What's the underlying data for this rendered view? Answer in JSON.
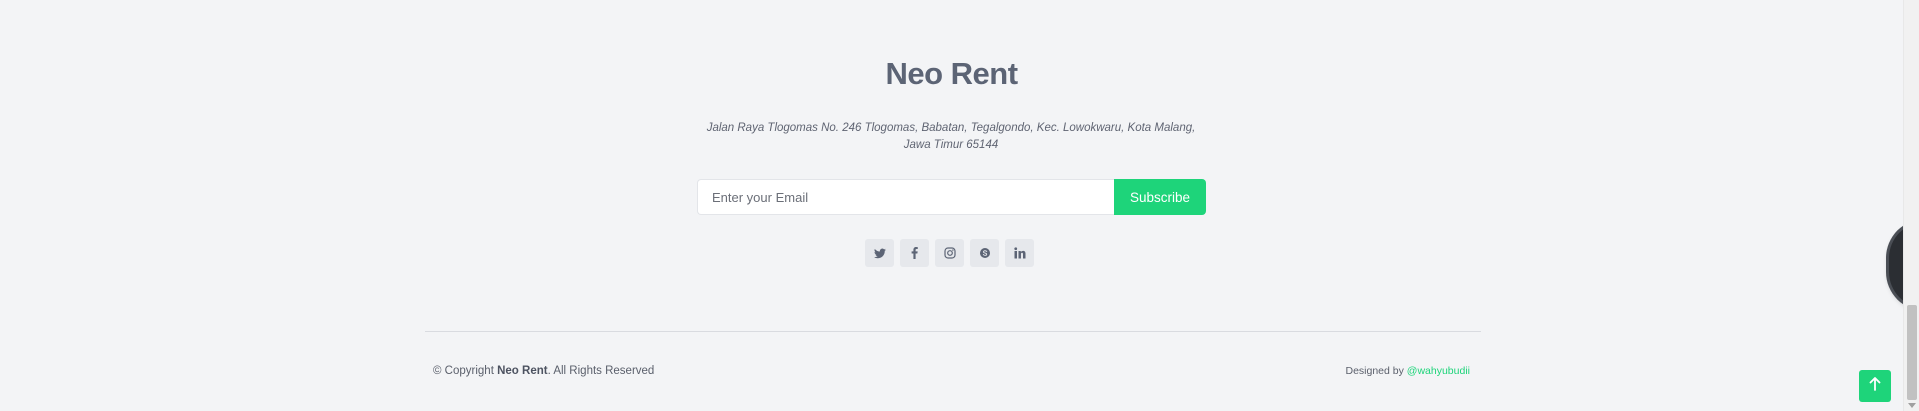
{
  "footer": {
    "brand_title": "Neo Rent",
    "address": "Jalan Raya Tlogomas No. 246 Tlogomas, Babatan, Tegalgondo, Kec. Lowokwaru, Kota Malang, Jawa Timur 65144",
    "newsletter": {
      "email_placeholder": "Enter your Email",
      "email_value": "",
      "subscribe_label": "Subscribe"
    },
    "social_links": [
      {
        "name": "twitter-icon",
        "label": "twitter"
      },
      {
        "name": "facebook-icon",
        "label": "facebook"
      },
      {
        "name": "instagram-icon",
        "label": "instagram"
      },
      {
        "name": "skype-icon",
        "label": "skype"
      },
      {
        "name": "linkedin-icon",
        "label": "linkedin"
      }
    ],
    "copyright": {
      "prefix": "© Copyright ",
      "brand": "Neo Rent",
      "suffix": ". All Rights Reserved"
    },
    "credits": {
      "prefix": "Designed by ",
      "author": "@wahyubudii"
    }
  },
  "back_to_top": {
    "icon": "arrow-up-icon"
  },
  "colors": {
    "background": "#f3f4f6",
    "accent": "#1ed47a",
    "title": "#5c6475",
    "social_bg": "#e6e8ec"
  }
}
